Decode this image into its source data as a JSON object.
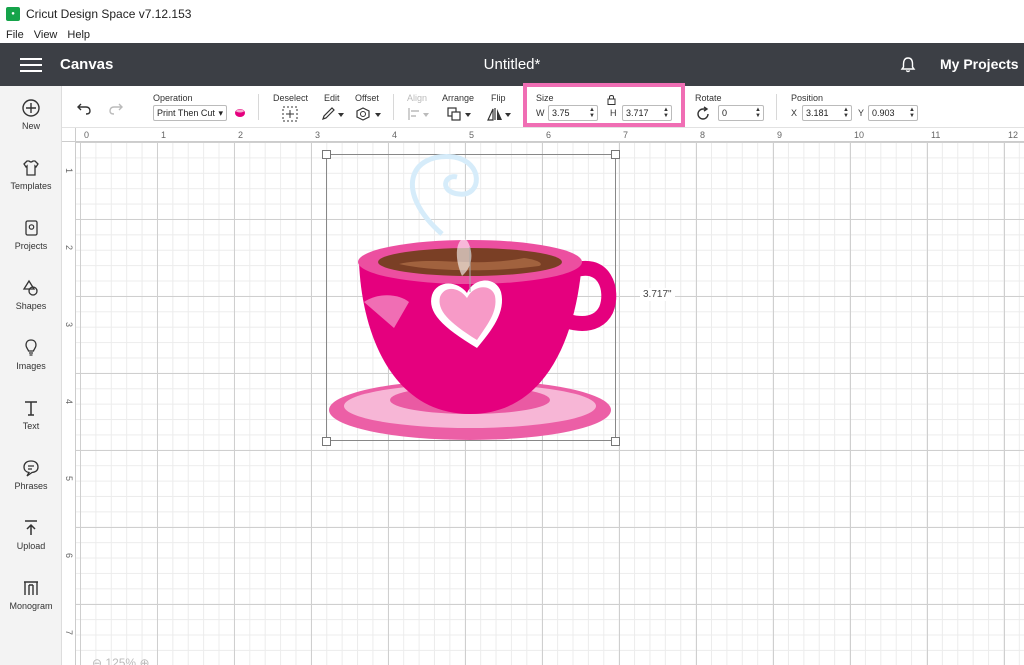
{
  "window": {
    "title": "Cricut Design Space  v7.12.153",
    "logo_text": "cricut"
  },
  "menu": [
    "File",
    "View",
    "Help"
  ],
  "header": {
    "canvas_label": "Canvas",
    "document_title": "Untitled*",
    "my_projects": "My Projects"
  },
  "sidebar": [
    {
      "label": "New",
      "icon": "plus-circle-icon"
    },
    {
      "label": "Templates",
      "icon": "shirt-icon"
    },
    {
      "label": "Projects",
      "icon": "projects-icon"
    },
    {
      "label": "Shapes",
      "icon": "shapes-icon"
    },
    {
      "label": "Images",
      "icon": "lightbulb-icon"
    },
    {
      "label": "Text",
      "icon": "text-icon"
    },
    {
      "label": "Phrases",
      "icon": "chat-icon"
    },
    {
      "label": "Upload",
      "icon": "upload-icon"
    },
    {
      "label": "Monogram",
      "icon": "monogram-icon"
    }
  ],
  "toolbar": {
    "operation_label": "Operation",
    "operation_value": "Print Then Cut",
    "deselect_label": "Deselect",
    "edit_label": "Edit",
    "offset_label": "Offset",
    "align_label": "Align",
    "arrange_label": "Arrange",
    "flip_label": "Flip",
    "size_label": "Size",
    "width_label": "W",
    "width_value": "3.75",
    "height_label": "H",
    "height_value": "3.717",
    "rotate_label": "Rotate",
    "rotate_value": "0",
    "position_label": "Position",
    "x_label": "X",
    "x_value": "3.181",
    "y_label": "Y",
    "y_value": "0.903",
    "highlight_color": "#f06eb4"
  },
  "ruler": {
    "top": [
      "0",
      "1",
      "2",
      "3",
      "4",
      "5",
      "6",
      "7",
      "8",
      "9",
      "10",
      "11",
      "12"
    ],
    "left": [
      "1",
      "2",
      "3",
      "4",
      "5",
      "6",
      "7"
    ]
  },
  "canvas": {
    "dimension_label": "3.717\"",
    "zoom": "125%"
  },
  "colors": {
    "appbar": "#3c3f45",
    "cup": "#e5007e",
    "saucer": "#f06eb4"
  }
}
